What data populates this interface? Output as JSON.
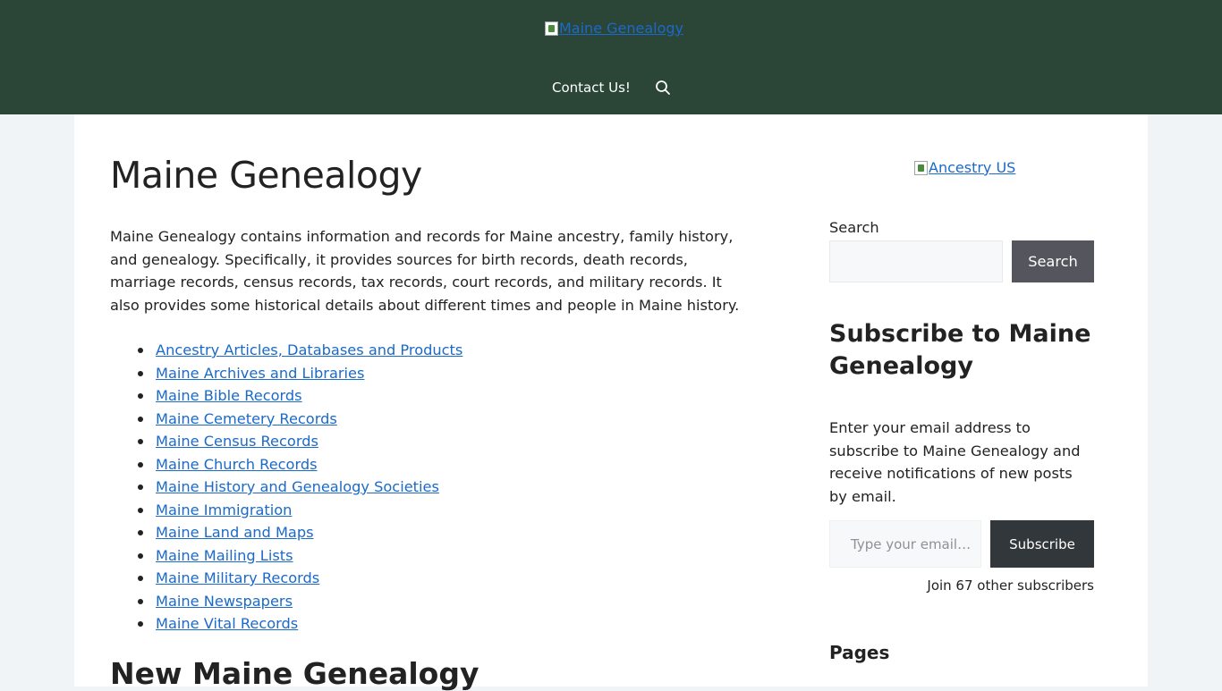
{
  "header": {
    "logo_alt": "Maine Genealogy",
    "nav": {
      "contact_label": "Contact Us!",
      "search_icon": "search-icon"
    }
  },
  "main": {
    "title": "Maine Genealogy",
    "intro": "Maine Genealogy contains information and records for Maine ancestry, family history, and genealogy. Specifically, it provides sources for birth records, death records, marriage records, census records, tax records, court records, and military records. It also provides some historical details about different times and people in Maine history.",
    "links": [
      "Ancestry Articles, Databases and Products",
      "Maine Archives and Libraries",
      "Maine Bible Records",
      "Maine Cemetery Records",
      "Maine Census Records",
      "Maine Church Records",
      "Maine History and Genealogy Societies",
      "Maine Immigration",
      "Maine Land and Maps",
      "Maine Mailing Lists",
      "Maine Military Records",
      "Maine Newspapers",
      "Maine Vital Records"
    ],
    "subheading": "New Maine Genealogy"
  },
  "sidebar": {
    "ad_alt": "Ancestry US",
    "search_label": "Search",
    "search_value": "",
    "search_button": "Search",
    "subscribe_title": "Subscribe to Maine Genealogy",
    "subscribe_text": "Enter your email address to subscribe to Maine Genealogy and receive notifications of new posts by email.",
    "email_placeholder": "Type your email…",
    "subscribe_button": "Subscribe",
    "subscriber_count": "Join 67 other subscribers",
    "pages_title": "Pages"
  },
  "colors": {
    "header_bg": "#2b4537",
    "link": "#1b6ac9",
    "search_button_bg": "#55555e",
    "subscribe_button_bg": "#32373c",
    "page_bg": "#f0f4f6"
  }
}
